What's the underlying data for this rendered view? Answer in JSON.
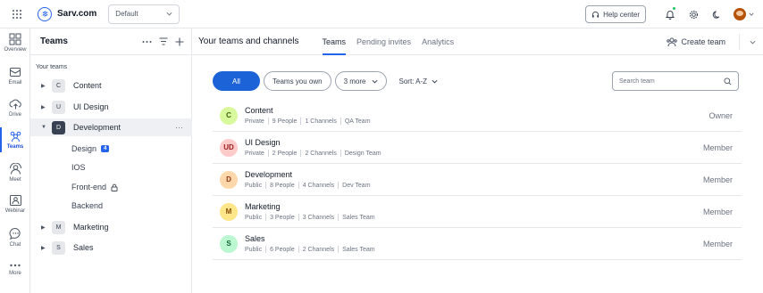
{
  "topbar": {
    "brand_name": "Sarv.com",
    "workspace": "Default",
    "help_label": "Help center"
  },
  "rail": {
    "items": [
      {
        "label": "Overview",
        "icon": "grid-icon"
      },
      {
        "label": "Email",
        "icon": "mail-icon"
      },
      {
        "label": "Drive",
        "icon": "cloud-icon"
      },
      {
        "label": "Teams",
        "icon": "people-icon",
        "active": true
      },
      {
        "label": "Meet",
        "icon": "meet-icon"
      },
      {
        "label": "Webinar",
        "icon": "webinar-icon"
      },
      {
        "label": "Chat",
        "icon": "chat-icon"
      },
      {
        "label": "More",
        "icon": "more-icon"
      }
    ]
  },
  "panel": {
    "title": "Teams",
    "section_label": "Your teams",
    "teams": [
      {
        "letter": "C",
        "name": "Content"
      },
      {
        "letter": "U",
        "name": "UI Design"
      },
      {
        "letter": "D",
        "name": "Development"
      },
      {
        "letter": "M",
        "name": "Marketing"
      },
      {
        "letter": "S",
        "name": "Sales"
      }
    ],
    "channels": [
      {
        "name": "Design",
        "badge": "4"
      },
      {
        "name": "IOS"
      },
      {
        "name": "Front-end"
      },
      {
        "name": "Backend"
      }
    ]
  },
  "main": {
    "title": "Your teams and channels",
    "tabs": [
      "Teams",
      "Pending invites",
      "Analytics"
    ],
    "create_label": "Create team",
    "filters": {
      "all": "All",
      "own": "Teams you own",
      "more": "3 more",
      "sort": "Sort: A-Z"
    },
    "search_placeholder": "Search team",
    "rows": [
      {
        "initials": "C",
        "name": "Content",
        "visibility": "Private",
        "people": "9 People",
        "channels": "1 Channels",
        "group": "QA Team",
        "role": "Owner",
        "bg": "#d9f99d",
        "fg": "#3f6212"
      },
      {
        "initials": "UD",
        "name": "UI Design",
        "visibility": "Private",
        "people": "2 People",
        "channels": "2 Channels",
        "group": "Design Team",
        "role": "Member",
        "bg": "#fecaca",
        "fg": "#991b1b"
      },
      {
        "initials": "D",
        "name": "Development",
        "visibility": "Public",
        "people": "8 People",
        "channels": "4 Channels",
        "group": "Dev Team",
        "role": "Member",
        "bg": "#fed7aa",
        "fg": "#9a3412"
      },
      {
        "initials": "M",
        "name": "Marketing",
        "visibility": "Public",
        "people": "3 People",
        "channels": "3 Channels",
        "group": "Sales Team",
        "role": "Member",
        "bg": "#fde68a",
        "fg": "#854d0e"
      },
      {
        "initials": "S",
        "name": "Sales",
        "visibility": "Public",
        "people": "6 People",
        "channels": "2 Channels",
        "group": "Sales Team",
        "role": "Member",
        "bg": "#bbf7d0",
        "fg": "#166534"
      }
    ]
  },
  "colors": {
    "accent": "#1d63d8",
    "selected_row": "#eef0f3"
  }
}
